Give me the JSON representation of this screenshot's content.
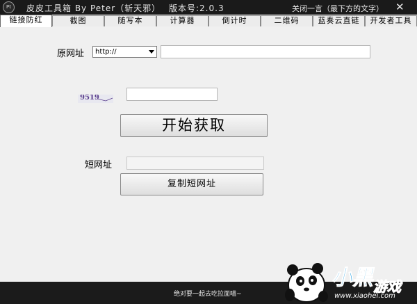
{
  "titlebar": {
    "icon_text": "Pt",
    "title": "皮皮工具箱 By Peter（斩天邪）",
    "version": "版本号:2.0.3",
    "close_quote_label": "关闭一言（最下方的文字）",
    "close_symbol": "✕"
  },
  "tabs": [
    {
      "label": "链接防红",
      "active": true
    },
    {
      "label": "截图",
      "active": false
    },
    {
      "label": "随写本",
      "active": false
    },
    {
      "label": "计算器",
      "active": false
    },
    {
      "label": "倒计时",
      "active": false
    },
    {
      "label": "二维码",
      "active": false
    },
    {
      "label": "蓝奏云直链",
      "active": false
    },
    {
      "label": "开发者工具",
      "active": false
    }
  ],
  "form": {
    "original_url_label": "原网址",
    "protocol_selected": "http://",
    "url_value": "",
    "captcha_text": "9519",
    "captcha_value": "",
    "fetch_button": "开始获取",
    "short_url_label": "短网址",
    "short_url_value": "",
    "copy_button": "复制短网址"
  },
  "footer": {
    "quote": "绝对要一起去吃拉面喵~"
  },
  "watermark": {
    "brand": "小黑",
    "brand_suffix": "游戏",
    "url": "www.xiaohei.com"
  },
  "colors": {
    "titlebar_bg": "#1a1a1a",
    "window_bg": "#f0f0f0",
    "footer_bg": "#1b1b1b",
    "watermark_blue": "#1f9de0",
    "watermark_pink": "#e63a8a"
  },
  "icons": [
    "app-logo-icon",
    "close-icon",
    "dropdown-arrow-icon",
    "panda-mascot-icon"
  ]
}
